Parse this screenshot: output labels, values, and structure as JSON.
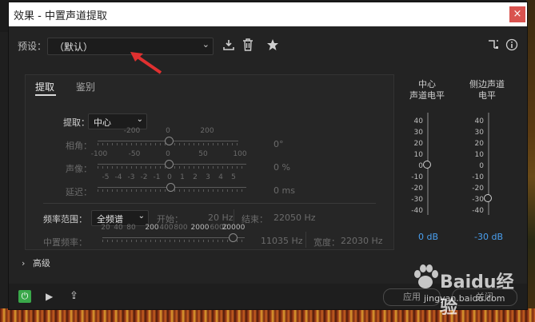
{
  "window": {
    "title": "效果 - 中置声道提取",
    "close_glyph": "×"
  },
  "preset": {
    "label": "预设：",
    "value": "（默认）",
    "chevron": "⌄"
  },
  "toolbar": {
    "save_icon": "download-icon",
    "delete_icon": "trash-icon",
    "favorite_icon": "star-icon",
    "routing_icon": "routing-icon",
    "info_icon": "info-icon"
  },
  "tabs": [
    {
      "label": "提取",
      "active": true
    },
    {
      "label": "鉴别",
      "active": false
    }
  ],
  "extract": {
    "label": "提取：",
    "value": "中心",
    "phase": {
      "label": "相角：",
      "ticks": [
        "-200",
        "0",
        "200"
      ],
      "value": "0°",
      "level": 0
    },
    "pan": {
      "label": "声像：",
      "ticks": [
        "-100",
        "-50",
        "0",
        "50",
        "100"
      ],
      "value": "0 %",
      "level": 0
    },
    "delay": {
      "label": "延迟：",
      "ticks": [
        "-5",
        "-4",
        "-3",
        "-2",
        "-1",
        "0",
        "1",
        "2",
        "3",
        "4",
        "5"
      ],
      "value": "0 ms",
      "level": 0
    }
  },
  "freq": {
    "label": "频率范围：",
    "value": "全频谱",
    "start_label": "开始：",
    "start_value": "20 Hz",
    "end_label": "结束：",
    "end_value": "22050 Hz",
    "center_label": "中置频率：",
    "center_ticks": [
      "20",
      "40",
      "80",
      "200",
      "400",
      "800",
      "2000",
      "6000",
      "20000"
    ],
    "center_value": "11035 Hz",
    "width_label": "宽度：",
    "width_value": "22030 Hz"
  },
  "meters": {
    "center": {
      "title_line1": "中心",
      "title_line2": "声道电平",
      "value": "0 dB",
      "level_db": 0
    },
    "side": {
      "title_line1": "侧边声道",
      "title_line2": "电平",
      "value": "-30 dB",
      "level_db": -30
    },
    "scale": [
      "40",
      "30",
      "20",
      "10",
      "0",
      "-10",
      "-20",
      "-30",
      "-40"
    ]
  },
  "advanced": {
    "label": "高级",
    "chevron": "›"
  },
  "bottom": {
    "power_glyph": "⏻",
    "play_glyph": "▶",
    "loop_glyph": "⇪",
    "apply_label": "应用",
    "close_label": "关闭"
  },
  "watermark": {
    "brand": "Baidu经验",
    "url": "jingyan.baidu.com"
  },
  "colors": {
    "accent_blue": "#4aa0f0",
    "power_green": "#3aa84a",
    "arrow_red": "#e03030"
  }
}
